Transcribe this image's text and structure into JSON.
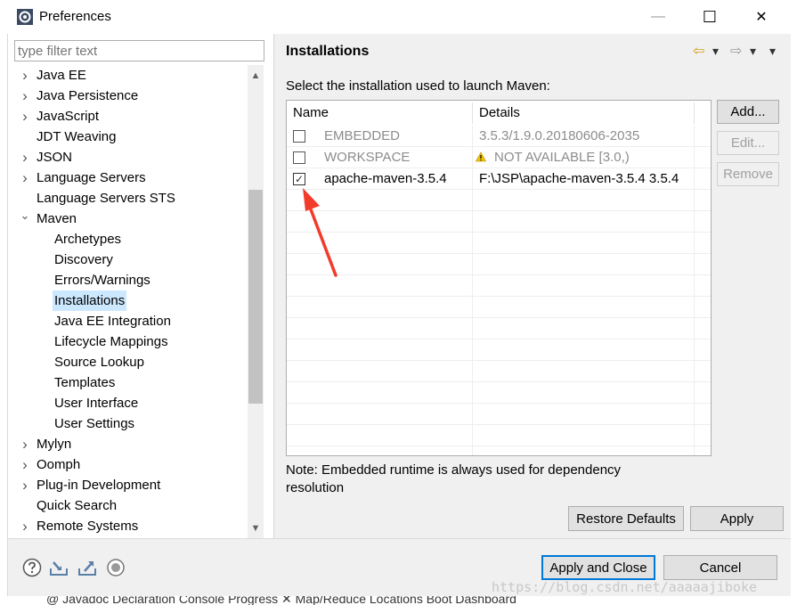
{
  "window": {
    "title": "Preferences",
    "minimize_glyph": "—",
    "maximize_glyph": "☐",
    "close_glyph": "✕"
  },
  "filter": {
    "placeholder": "type filter text"
  },
  "tree": {
    "items": [
      {
        "label": "Java EE",
        "expander": "›"
      },
      {
        "label": "Java Persistence",
        "expander": "›"
      },
      {
        "label": "JavaScript",
        "expander": "›"
      },
      {
        "label": "JDT Weaving",
        "expander": ""
      },
      {
        "label": "JSON",
        "expander": "›"
      },
      {
        "label": "Language Servers",
        "expander": "›"
      },
      {
        "label": "Language Servers STS",
        "expander": ""
      },
      {
        "label": "Maven",
        "expander": "⌄"
      },
      {
        "label": "Archetypes",
        "expander": ""
      },
      {
        "label": "Discovery",
        "expander": ""
      },
      {
        "label": "Errors/Warnings",
        "expander": ""
      },
      {
        "label": "Installations",
        "expander": ""
      },
      {
        "label": "Java EE Integration",
        "expander": ""
      },
      {
        "label": "Lifecycle Mappings",
        "expander": ""
      },
      {
        "label": "Source Lookup",
        "expander": ""
      },
      {
        "label": "Templates",
        "expander": ""
      },
      {
        "label": "User Interface",
        "expander": ""
      },
      {
        "label": "User Settings",
        "expander": ""
      },
      {
        "label": "Mylyn",
        "expander": "›"
      },
      {
        "label": "Oomph",
        "expander": "›"
      },
      {
        "label": "Plug-in Development",
        "expander": "›"
      },
      {
        "label": "Quick Search",
        "expander": ""
      },
      {
        "label": "Remote Systems",
        "expander": "›"
      }
    ],
    "selected": "Installations",
    "scroll_up_glyph": "▲",
    "scroll_down_glyph": "▼"
  },
  "page": {
    "title": "Installations",
    "instruction": "Select the installation used to launch Maven:",
    "note": "Note: Embedded runtime is always used for dependency resolution",
    "nav": {
      "back": "⇦",
      "back_menu": "▾",
      "forward": "⇨",
      "forward_menu": "▾",
      "view_menu": "▾"
    }
  },
  "table": {
    "columns": [
      "Name",
      "Details"
    ],
    "rows": [
      {
        "checked": false,
        "check_glyph": "",
        "name": "EMBEDDED",
        "details": "3.5.3/1.9.0.20180606-2035",
        "disabled": true,
        "warning": false
      },
      {
        "checked": false,
        "check_glyph": "",
        "name": "WORKSPACE",
        "details": "NOT AVAILABLE [3.0,)",
        "disabled": true,
        "warning": true
      },
      {
        "checked": true,
        "check_glyph": "✓",
        "name": "apache-maven-3.5.4",
        "details": "F:\\JSP\\apache-maven-3.5.4 3.5.4",
        "disabled": false,
        "warning": false
      }
    ]
  },
  "side_buttons": {
    "add": "Add...",
    "edit": "Edit...",
    "remove": "Remove"
  },
  "buttons": {
    "restore_defaults": "Restore Defaults",
    "apply": "Apply",
    "apply_close": "Apply and Close",
    "cancel": "Cancel"
  },
  "bottom_tabs": "@ Javadoc  Declaration  Console  Progress ✕  Map/Reduce Locations  Boot Dashboard",
  "watermark": "https://blog.csdn.net/aaaaajiboke",
  "colors": {
    "selection": "#cce8ff",
    "default_button_border": "#0078d7",
    "annotation_arrow": "#f23b2b"
  }
}
